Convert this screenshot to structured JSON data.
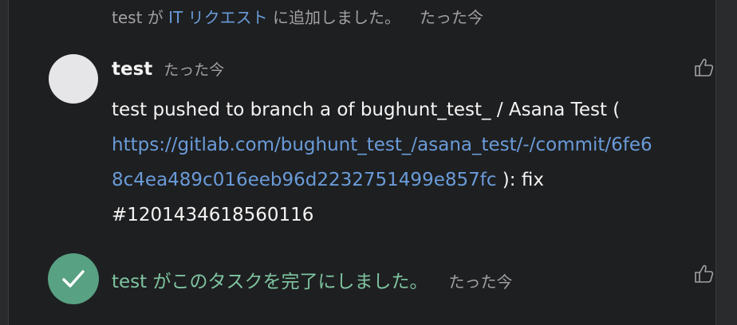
{
  "story": {
    "actor": "test",
    "middle": " が ",
    "project_link": "IT リクエスト",
    "suffix": " に追加しました。",
    "time": "たった今"
  },
  "comment": {
    "author": "test",
    "time": "たった今",
    "text_line1": "test pushed to branch a of bughunt_test_ / Asana Test (",
    "link_part1": "https://gitlab.com/bughunt_test_/asana_test/-/commit/6fe6",
    "link_part2": "8c4ea489c016eeb96d2232751499e857fc",
    "text_after_link": " ): fix",
    "text_line4": "#1201434618560116"
  },
  "completion": {
    "actor": "test",
    "action": " がこのタスクを完了にしました。",
    "time": "たった今"
  },
  "icons": {
    "like": "thumbs-up-icon",
    "check": "checkmark-icon"
  },
  "colors": {
    "background": "#1e1f21",
    "link": "#6a9bd8",
    "complete_green": "#58a182",
    "complete_text": "#7fc4a0"
  }
}
